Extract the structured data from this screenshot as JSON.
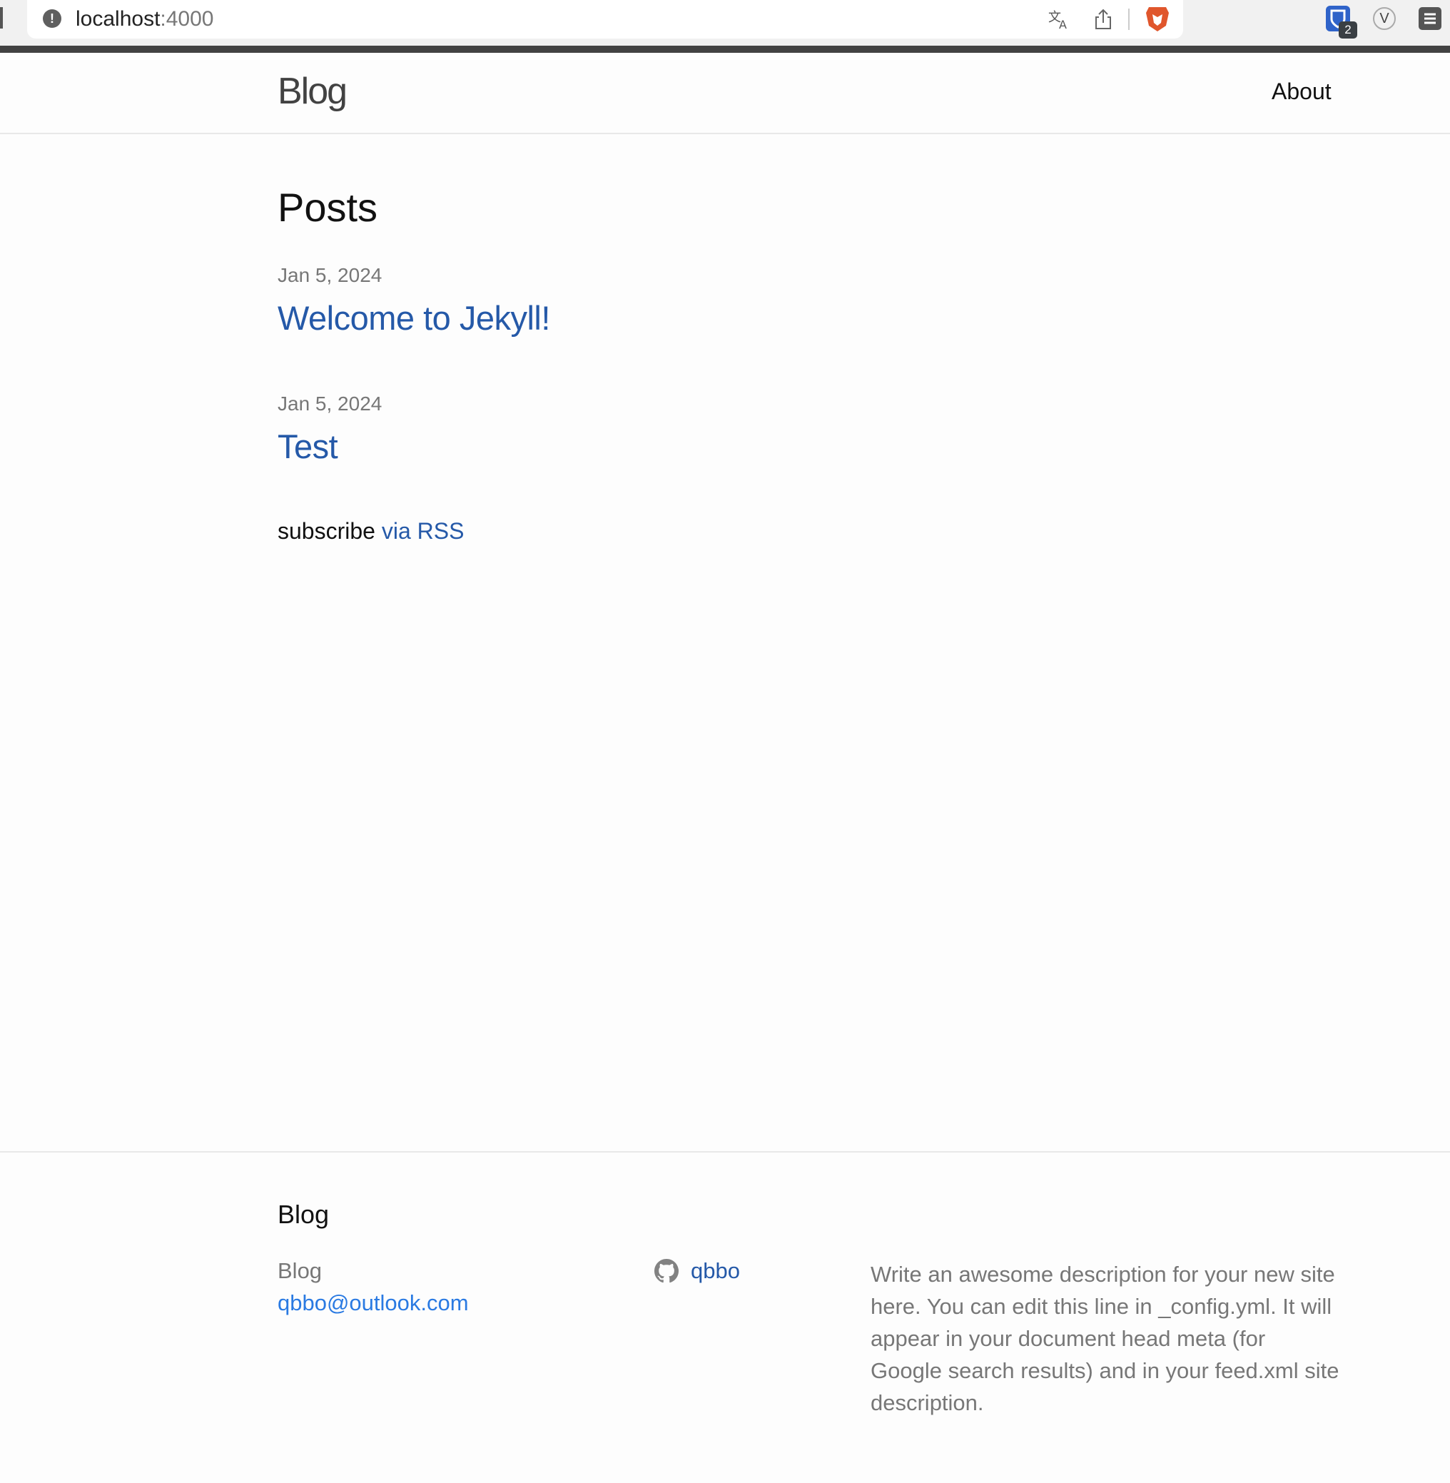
{
  "browser": {
    "url_host": "localhost",
    "url_port": ":4000",
    "info_icon": "!",
    "translate_icon": "translate-icon",
    "bitwarden_badge": "2",
    "v_extension": "V"
  },
  "header": {
    "site_title": "Blog",
    "nav": [
      {
        "label": "About"
      }
    ]
  },
  "main": {
    "heading": "Posts",
    "posts": [
      {
        "date": "Jan 5, 2024",
        "title": "Welcome to Jekyll!"
      },
      {
        "date": "Jan 5, 2024",
        "title": "Test"
      }
    ],
    "subscribe_text": "subscribe",
    "rss_link": "via RSS"
  },
  "footer": {
    "heading": "Blog",
    "name": "Blog",
    "email": "qbbo@outlook.com",
    "github_user": "qbbo",
    "description": "Write an awesome description for your new site here. You can edit this line in _config.yml. It will appear in your document head meta (for Google search results) and in your feed.xml site description."
  },
  "colors": {
    "link": "#2559a8",
    "email_link": "#2a7ae2",
    "muted": "#777777",
    "brave": "#e0562c",
    "bitwarden": "#2f63c9"
  }
}
